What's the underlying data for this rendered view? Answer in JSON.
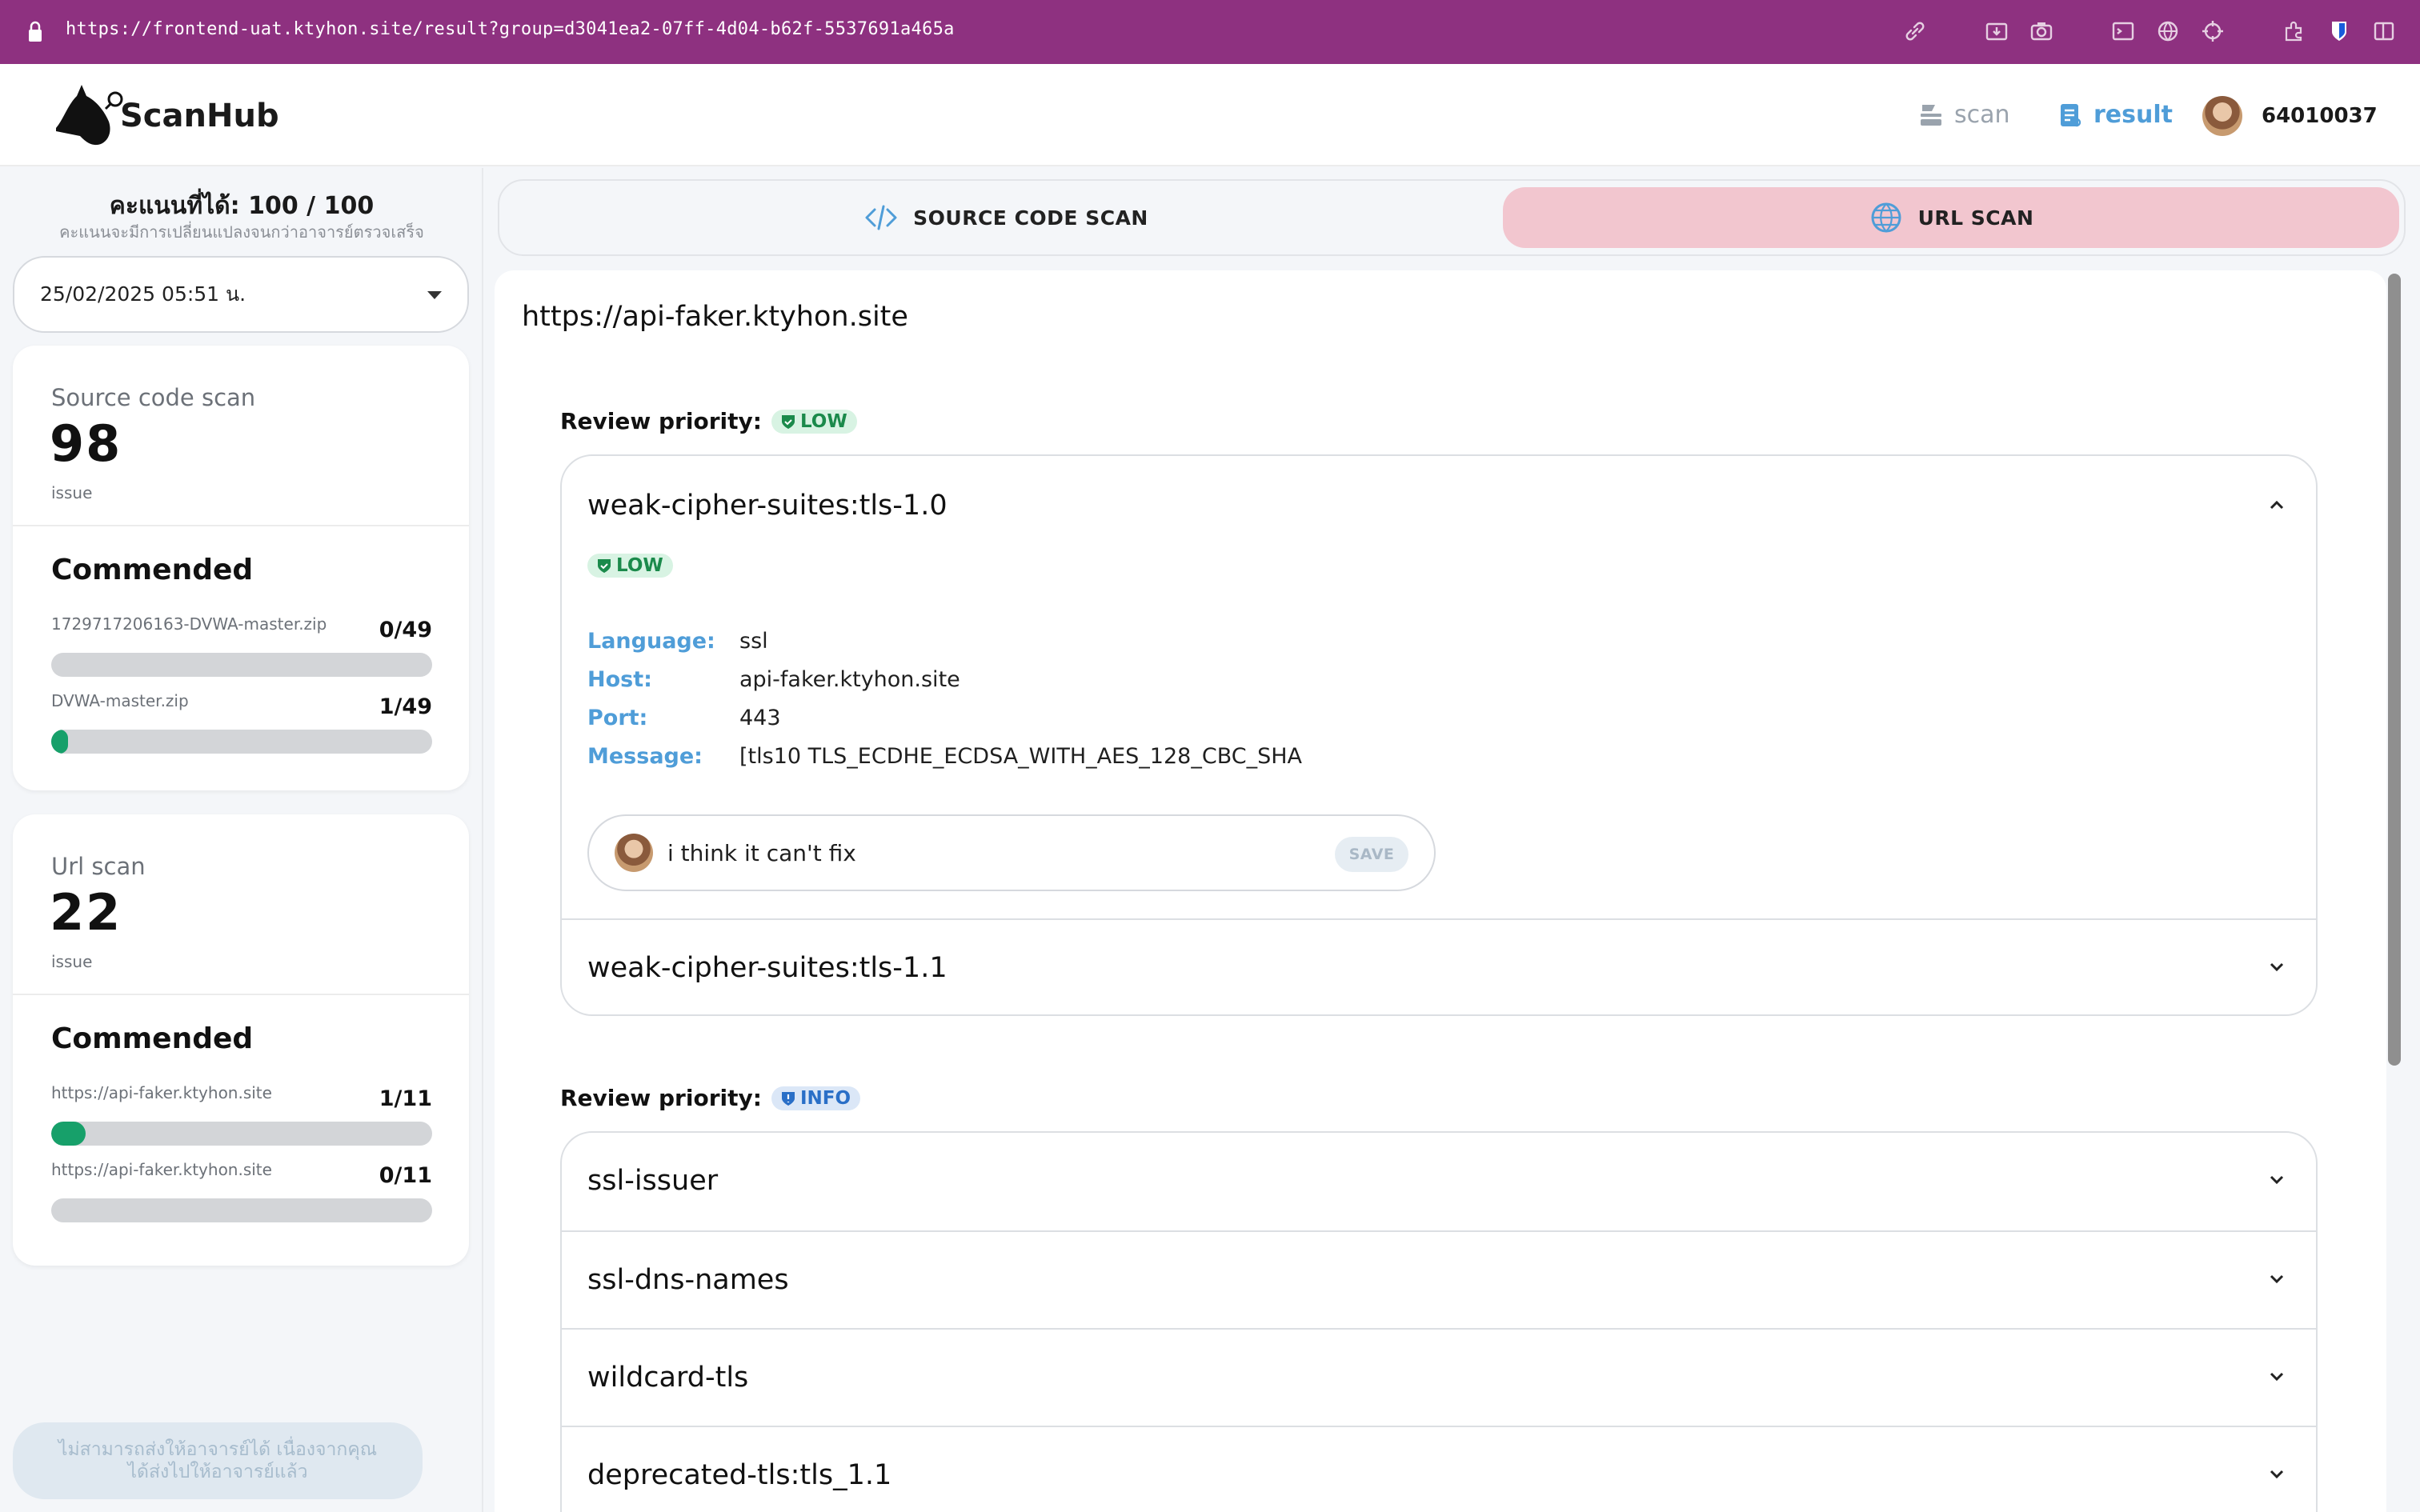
{
  "browser": {
    "url": "https://frontend-uat.ktyhon.site/result?group=d3041ea2-07ff-4d04-b62f-5537691a465a",
    "accent_color": "#8e3180"
  },
  "header": {
    "brand": "ScanHub",
    "nav": {
      "scan_label": "scan",
      "result_label": "result"
    },
    "user_id": "64010037"
  },
  "sidebar": {
    "score_title": "คะแนนที่ได้: 100 / 100",
    "score_note": "คะแนนจะมีการเปลี่ยนแปลงจนกว่าอาจารย์ตรวจเสร็จ",
    "selected_date": "25/02/2025 05:51 น.",
    "source_card": {
      "label": "Source code scan",
      "count": "98",
      "unit": "issue",
      "commended_title": "Commended",
      "items": [
        {
          "name": "1729717206163-DVWA-master.zip",
          "value": "0/49",
          "fraction": 0.0
        },
        {
          "name": "DVWA-master.zip",
          "value": "1/49",
          "fraction": 0.0204
        }
      ]
    },
    "url_card": {
      "label": "Url scan",
      "count": "22",
      "unit": "issue",
      "commended_title": "Commended",
      "items": [
        {
          "name": "https://api-faker.ktyhon.site",
          "value": "1/11",
          "fraction": 0.0909
        },
        {
          "name": "https://api-faker.ktyhon.site",
          "value": "0/11",
          "fraction": 0.0
        }
      ]
    },
    "send_button_text": [
      "ไม่สามารถส่งให้อาจารย์ได้ เนื่องจากคุณ",
      "ได้ส่งไปให้อาจารย์แล้ว"
    ]
  },
  "tabs": {
    "source_label": "SOURCE CODE SCAN",
    "url_label": "URL SCAN",
    "active": "url",
    "active_color": "#f2c6cf"
  },
  "main": {
    "target_url": "https://api-faker.ktyhon.site",
    "review_priority_label": "Review priority:",
    "groups": [
      {
        "priority": "LOW",
        "items": [
          {
            "title": "weak-cipher-suites:tls-1.0",
            "expanded": true,
            "severity": "LOW",
            "details": [
              {
                "key": "Language:",
                "value": "ssl"
              },
              {
                "key": "Host:",
                "value": "api-faker.ktyhon.site"
              },
              {
                "key": "Port:",
                "value": "443"
              },
              {
                "key": "Message:",
                "value": "[tls10 TLS_ECDHE_ECDSA_WITH_AES_128_CBC_SHA"
              }
            ],
            "comment": "i think it can't fix",
            "save_label": "SAVE"
          },
          {
            "title": "weak-cipher-suites:tls-1.1",
            "expanded": false
          }
        ]
      },
      {
        "priority": "INFO",
        "items": [
          {
            "title": "ssl-issuer",
            "expanded": false
          },
          {
            "title": "ssl-dns-names",
            "expanded": false
          },
          {
            "title": "wildcard-tls",
            "expanded": false
          },
          {
            "title": "deprecated-tls:tls_1.1",
            "expanded": false
          }
        ]
      }
    ]
  }
}
